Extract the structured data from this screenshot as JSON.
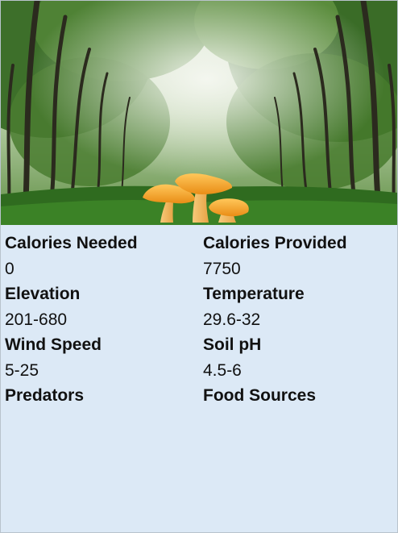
{
  "scene": {
    "subject": "chanterelle mushrooms in a misty green forest",
    "colors": {
      "sky": "#f2f4ee",
      "foliage": "#3f7a2c",
      "grass": "#2f6b1f",
      "mushroom": "#f0a02a",
      "panel": "#dce9f6"
    }
  },
  "stats": {
    "calories_needed": {
      "label": "Calories Needed",
      "value": "0"
    },
    "calories_provided": {
      "label": "Calories Provided",
      "value": "7750"
    },
    "elevation": {
      "label": "Elevation",
      "value": "201-680"
    },
    "temperature": {
      "label": "Temperature",
      "value": "29.6-32"
    },
    "wind_speed": {
      "label": "Wind Speed",
      "value": "5-25"
    },
    "soil_ph": {
      "label": "Soil pH",
      "value": "4.5-6"
    },
    "predators": {
      "label": "Predators",
      "value": ""
    },
    "food_sources": {
      "label": "Food Sources",
      "value": ""
    }
  }
}
